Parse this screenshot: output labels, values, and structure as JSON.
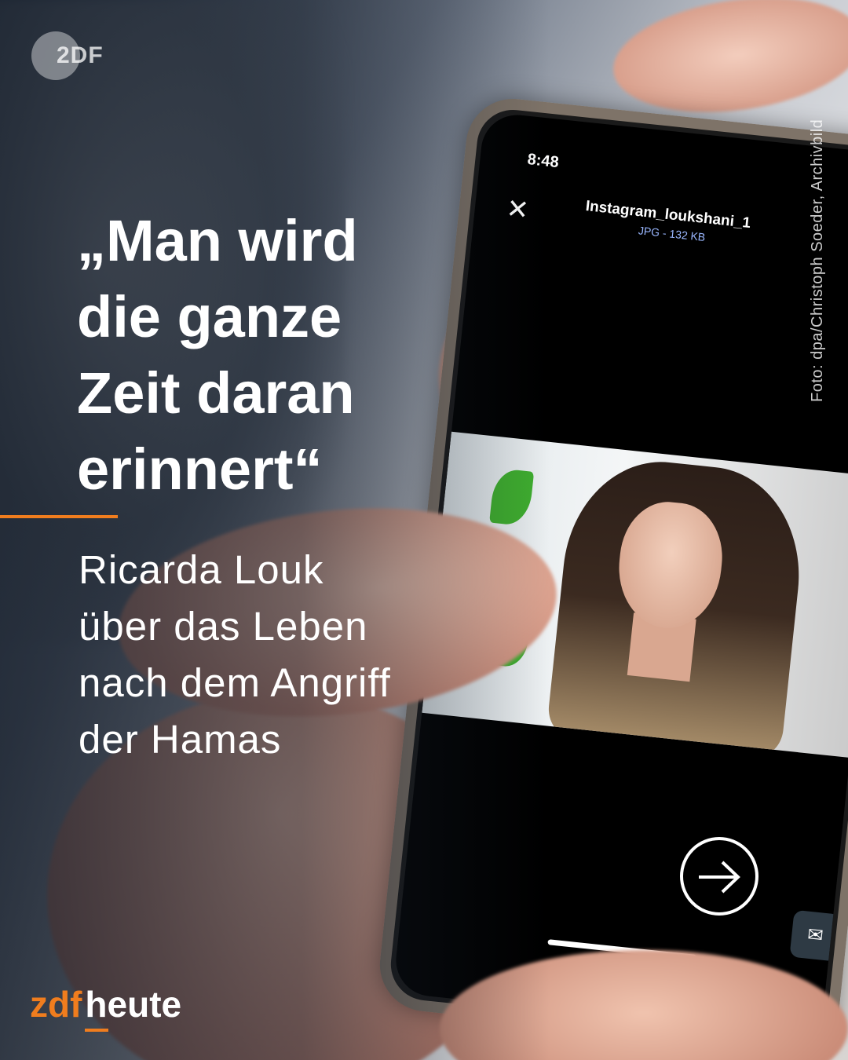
{
  "logo": {
    "text": "2DF"
  },
  "headline": {
    "lines": [
      "„Man wird",
      "die ganze",
      "Zeit daran",
      "erinnert“"
    ]
  },
  "subtitle": {
    "lines": [
      "Ricarda Louk",
      "über das Leben",
      "nach dem Angriff",
      "der Hamas"
    ]
  },
  "credit": "Foto: dpa/Christoph Soeder, Archivbild",
  "phone": {
    "time": "8:48",
    "close_icon": "close-icon",
    "file_name": "Instagram_loukshani_1",
    "file_meta": "JPG - 132 KB"
  },
  "next_button": {
    "icon": "arrow-right-circle-icon"
  },
  "brand": {
    "part1": "zdf",
    "part2": "heute"
  },
  "colors": {
    "accent": "#f07d1e",
    "text": "#ffffff"
  }
}
